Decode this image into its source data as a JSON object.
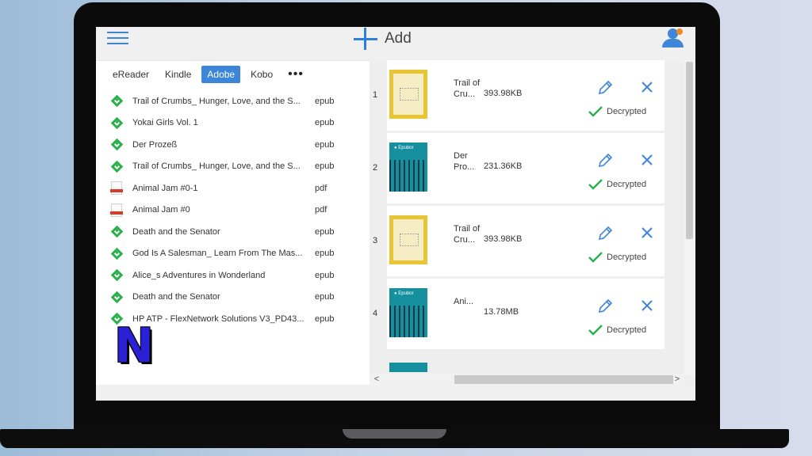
{
  "header": {
    "add_label": "Add",
    "menu_icon": "hamburger-menu-icon",
    "user_icon": "user-avatar-icon"
  },
  "tabs": [
    {
      "label": "eReader",
      "active": false
    },
    {
      "label": "Kindle",
      "active": false
    },
    {
      "label": "Adobe",
      "active": true
    },
    {
      "label": "Kobo",
      "active": false
    },
    {
      "label": "•••",
      "active": false
    }
  ],
  "library": [
    {
      "name": "Trail of Crumbs_ Hunger, Love, and the S...",
      "format": "epub",
      "icon": "epub-icon"
    },
    {
      "name": "Yokai Girls Vol. 1",
      "format": "epub",
      "icon": "epub-icon"
    },
    {
      "name": "Der Prozeß",
      "format": "epub",
      "icon": "epub-icon"
    },
    {
      "name": "Trail of Crumbs_ Hunger, Love, and the S...",
      "format": "epub",
      "icon": "epub-icon"
    },
    {
      "name": "Animal Jam #0-1",
      "format": "pdf",
      "icon": "pdf-icon"
    },
    {
      "name": "Animal Jam #0",
      "format": "pdf",
      "icon": "pdf-icon"
    },
    {
      "name": "Death and the Senator",
      "format": "epub",
      "icon": "epub-icon"
    },
    {
      "name": "God Is A Salesman_ Learn From The Mas...",
      "format": "epub",
      "icon": "epub-icon"
    },
    {
      "name": "Alice_s Adventures in Wonderland",
      "format": "epub",
      "icon": "epub-icon"
    },
    {
      "name": "Death and the Senator",
      "format": "epub",
      "icon": "epub-icon"
    },
    {
      "name": "HP ATP - FlexNetwork Solutions V3_PD43...",
      "format": "epub",
      "icon": "epub-icon"
    }
  ],
  "logo_text": "N",
  "decrypt_queue": [
    {
      "index": "1",
      "title": "Trail of Cru...",
      "size": "393.98KB",
      "status": "Decrypted",
      "cover": "yellow"
    },
    {
      "index": "2",
      "title": "Der Pro...",
      "size": "231.36KB",
      "status": "Decrypted",
      "cover": "teal"
    },
    {
      "index": "3",
      "title": "Trail of Cru...",
      "size": "393.98KB",
      "status": "Decrypted",
      "cover": "yellow"
    },
    {
      "index": "4",
      "title": "Ani...",
      "size": "13.78MB",
      "status": "Decrypted",
      "cover": "teal"
    }
  ],
  "scroll": {
    "left_arrow": "<",
    "right_arrow": ">"
  },
  "colors": {
    "accent": "#3c85d8",
    "epub_green": "#2bb04c",
    "check_green": "#2bb04c"
  }
}
